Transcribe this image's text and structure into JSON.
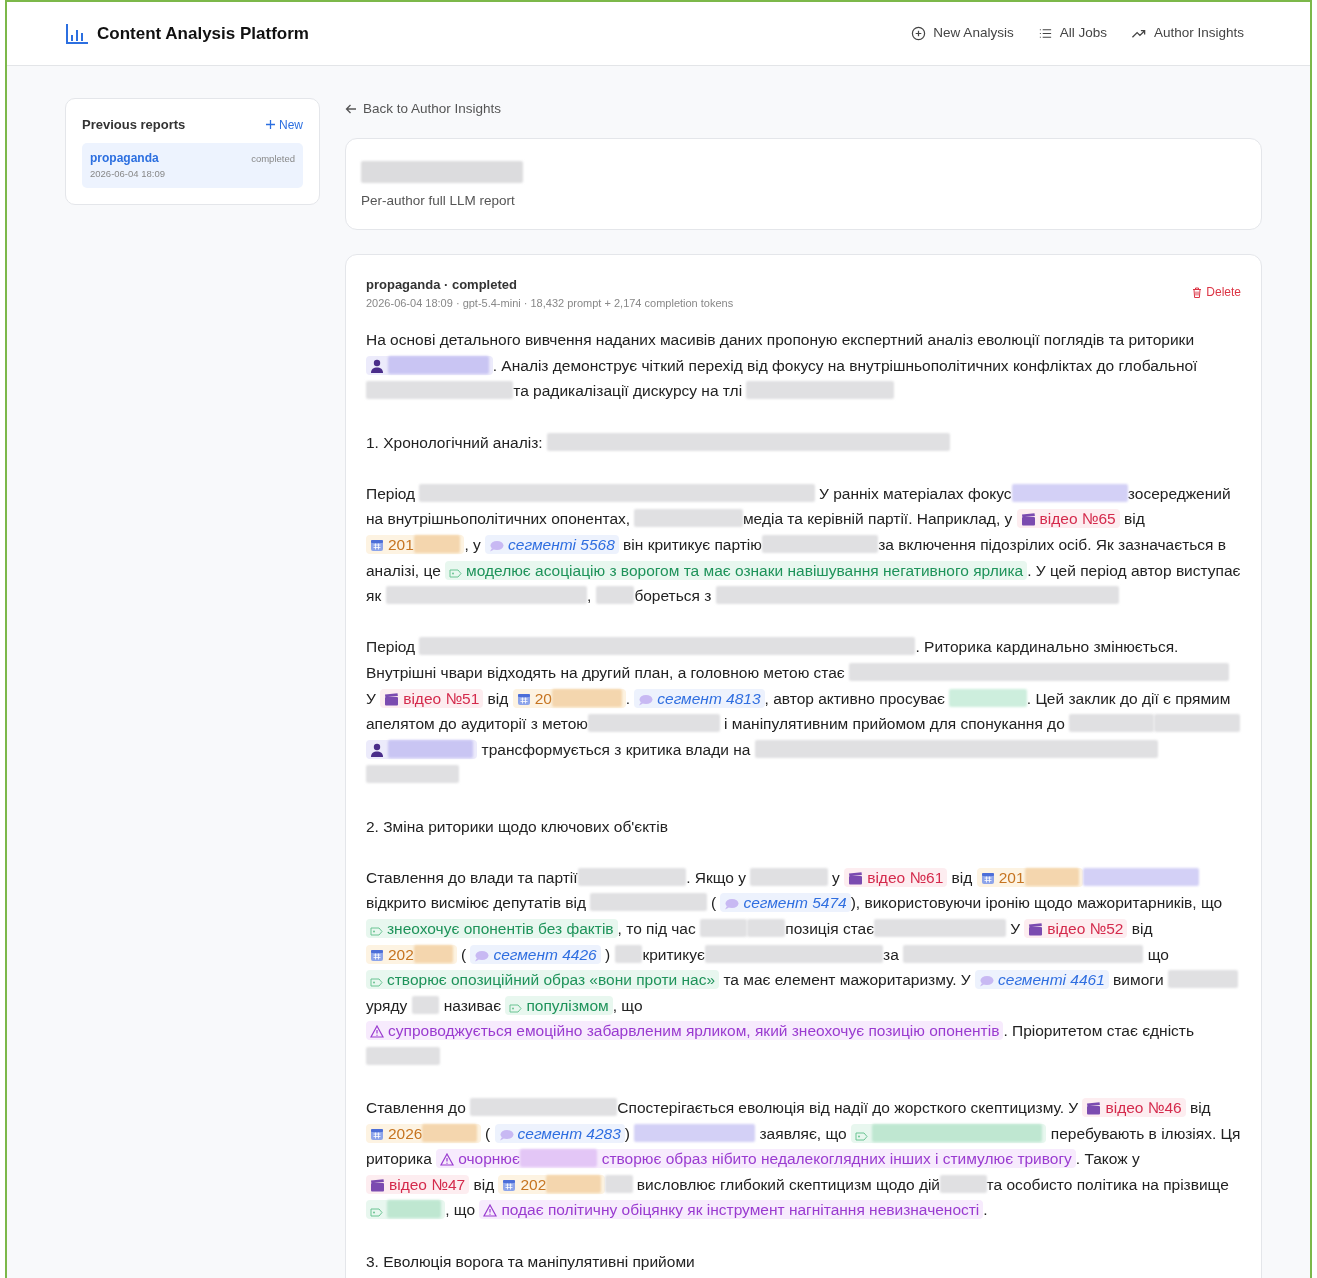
{
  "navbar": {
    "brand": "Content Analysis Platform",
    "links": [
      {
        "label": "New Analysis"
      },
      {
        "label": "All Jobs"
      },
      {
        "label": "Author Insights"
      }
    ]
  },
  "sidebar": {
    "title": "Previous reports",
    "new_label": "New",
    "reports": [
      {
        "name": "propaganda",
        "status": "completed",
        "date": "2026-06-04 18:09",
        "selected": true
      }
    ]
  },
  "back_link": "Back to Author Insights",
  "report_header": {
    "title_redacted": true,
    "subtitle": "Per-author full LLM report"
  },
  "report": {
    "title": "propaganda · completed",
    "meta": "2026-06-04 18:09 · gpt-5.4-mini · 18,432 prompt + 2,174 completion tokens",
    "delete_label": "Delete",
    "paragraphs": [
      [
        {
          "kind": "text",
          "text": "На основі детального вивчення наданих масивів даних пропоную експертний аналіз еволюції поглядів та риторики "
        },
        {
          "kind": "person",
          "parts": [
            {
              "redacted": true
            }
          ]
        },
        {
          "kind": "text",
          "text": ". Аналіз демонструє чіткий перехід від фокусу на внутрішньополітичних конфліктах до глобальної "
        },
        {
          "kind": "redacted",
          "color": "#e0e0e2"
        },
        {
          "kind": "text",
          "text": "та радикалізації дискурсу на тлі "
        },
        {
          "kind": "redacted",
          "color": "#e0e0e2"
        }
      ],
      [
        {
          "kind": "text",
          "text": "1. Хронологічний аналіз: "
        },
        {
          "kind": "redacted",
          "color": "#e0e0e2"
        }
      ],
      [
        {
          "kind": "text",
          "text": "Період "
        },
        {
          "kind": "redacted",
          "color": "#e0e0e2"
        },
        {
          "kind": "text",
          "text": " У ранніх матеріалах фокус"
        },
        {
          "kind": "redacted",
          "color": "#d3d0f6"
        },
        {
          "kind": "text",
          "text": "зосереджений на внутрішньополітичних опонентах, "
        },
        {
          "kind": "redacted",
          "color": "#e0e0e2"
        },
        {
          "kind": "text",
          "text": "медіа та керівній партії. Наприклад, у "
        },
        {
          "kind": "video",
          "parts": [
            {
              "text": "відео №65"
            }
          ]
        },
        {
          "kind": "text",
          "text": " від "
        },
        {
          "kind": "date",
          "parts": [
            {
              "text": "201"
            },
            {
              "redacted": true
            }
          ]
        },
        {
          "kind": "text",
          "text": ", у "
        },
        {
          "kind": "segment",
          "parts": [
            {
              "text": "сегменті 5568"
            }
          ]
        },
        {
          "kind": "text",
          "text": " він критикує партію"
        },
        {
          "kind": "redacted",
          "color": "#e0e0e2"
        },
        {
          "kind": "text",
          "text": "за включення підозрілих осіб. Як зазначається в аналізі, це "
        },
        {
          "kind": "tag",
          "parts": [
            {
              "text": "моделює асоціацію з ворогом та має ознаки навішування негативного ярлика"
            }
          ]
        },
        {
          "kind": "text",
          "text": ". У цей період автор виступає як "
        },
        {
          "kind": "redacted",
          "color": "#e0e0e2"
        },
        {
          "kind": "text",
          "text": ", "
        },
        {
          "kind": "redacted",
          "color": "#e0e0e2"
        },
        {
          "kind": "text",
          "text": "бореться з "
        },
        {
          "kind": "redacted",
          "color": "#e0e0e2"
        }
      ],
      [
        {
          "kind": "text",
          "text": "Період "
        },
        {
          "kind": "redacted",
          "color": "#e0e0e2"
        },
        {
          "kind": "text",
          "text": ". Риторика кардинально змінюється. Внутрішні чвари відходять на другий план, а головною метою стає "
        },
        {
          "kind": "redacted",
          "color": "#e0e0e2"
        },
        {
          "kind": "text",
          "text": " У "
        },
        {
          "kind": "video",
          "parts": [
            {
              "text": "відео №51"
            }
          ]
        },
        {
          "kind": "text",
          "text": " від "
        },
        {
          "kind": "date",
          "parts": [
            {
              "text": "20"
            },
            {
              "redacted": true
            }
          ]
        },
        {
          "kind": "text",
          "text": ". "
        },
        {
          "kind": "segment",
          "parts": [
            {
              "text": "сегмент 4813"
            }
          ]
        },
        {
          "kind": "text",
          "text": ", автор активно просуває "
        },
        {
          "kind": "redacted",
          "color": "#cdeedd"
        },
        {
          "kind": "text",
          "text": ". Цей заклик до дії є прямим апелятом до аудиторії з метою"
        },
        {
          "kind": "redacted",
          "color": "#e0e0e2"
        },
        {
          "kind": "text",
          "text": " і маніпулятивним прийомом для спонукання до "
        },
        {
          "kind": "redacted",
          "color": "#e0e0e2"
        },
        {
          "kind": "redacted",
          "color": "#e0e0e2"
        },
        {
          "kind": "person",
          "parts": [
            {
              "redacted": true
            }
          ]
        },
        {
          "kind": "text",
          "text": " трансформується з критика влади на "
        },
        {
          "kind": "redacted",
          "color": "#e0e0e2"
        },
        {
          "kind": "redacted",
          "color": "#e0e0e2"
        }
      ],
      [
        {
          "kind": "text",
          "text": "2. Зміна риторики щодо ключових об'єктів"
        }
      ],
      [
        {
          "kind": "text",
          "text": "Ставлення до влади та партії"
        },
        {
          "kind": "redacted",
          "color": "#e0e0e2"
        },
        {
          "kind": "text",
          "text": ". Якщо у "
        },
        {
          "kind": "redacted",
          "color": "#e0e0e2"
        },
        {
          "kind": "text",
          "text": " у "
        },
        {
          "kind": "video",
          "parts": [
            {
              "text": "відео №61"
            }
          ]
        },
        {
          "kind": "text",
          "text": " від "
        },
        {
          "kind": "date",
          "parts": [
            {
              "text": "201"
            },
            {
              "redacted": true
            }
          ]
        },
        {
          "kind": "redacted",
          "color": "#d3d0f6"
        },
        {
          "kind": "text",
          "text": " відкрито висміює депутатів від "
        },
        {
          "kind": "redacted",
          "color": "#e0e0e2"
        },
        {
          "kind": "text",
          "text": " ( "
        },
        {
          "kind": "segment",
          "parts": [
            {
              "text": "сегмент 5474"
            }
          ]
        },
        {
          "kind": "text",
          "text": "), використовуючи іронію щодо мажоритарників, що "
        },
        {
          "kind": "tag",
          "parts": [
            {
              "text": "знеохочує опонентів без фактів"
            }
          ]
        },
        {
          "kind": "text",
          "text": ", то під час "
        },
        {
          "kind": "redacted",
          "color": "#e0e0e2"
        },
        {
          "kind": "redacted",
          "color": "#e0e0e2"
        },
        {
          "kind": "text",
          "text": "позиція стає"
        },
        {
          "kind": "redacted",
          "color": "#e0e0e2"
        },
        {
          "kind": "text",
          "text": " У "
        },
        {
          "kind": "video",
          "parts": [
            {
              "text": "відео №52"
            }
          ]
        },
        {
          "kind": "text",
          "text": " від "
        },
        {
          "kind": "date",
          "parts": [
            {
              "text": "202"
            },
            {
              "redacted": true
            }
          ]
        },
        {
          "kind": "text",
          "text": " ( "
        },
        {
          "kind": "segment",
          "parts": [
            {
              "text": "сегмент 4426"
            }
          ]
        },
        {
          "kind": "text",
          "text": " ) "
        },
        {
          "kind": "redacted",
          "color": "#e0e0e2"
        },
        {
          "kind": "text",
          "text": "критикує"
        },
        {
          "kind": "redacted",
          "color": "#e0e0e2"
        },
        {
          "kind": "text",
          "text": "за "
        },
        {
          "kind": "redacted",
          "color": "#e0e0e2"
        },
        {
          "kind": "text",
          "text": " що "
        },
        {
          "kind": "tag",
          "parts": [
            {
              "text": "створює опозиційний образ «вони проти нас»"
            }
          ]
        },
        {
          "kind": "text",
          "text": " та має елемент мажоритаризму. У "
        },
        {
          "kind": "segment",
          "parts": [
            {
              "text": "сегменті 4461"
            }
          ]
        },
        {
          "kind": "text",
          "text": " вимоги "
        },
        {
          "kind": "redacted",
          "color": "#e0e0e2"
        },
        {
          "kind": "text",
          "text": " уряду "
        },
        {
          "kind": "redacted",
          "color": "#e0e0e2"
        },
        {
          "kind": "text",
          "text": " називає "
        },
        {
          "kind": "tag",
          "parts": [
            {
              "text": "популізмом"
            }
          ]
        },
        {
          "kind": "text",
          "text": ", що "
        },
        {
          "kind": "warning",
          "parts": [
            {
              "text": "супроводжується емоційно забарвленим ярликом, який знеохочує позицію опонентів"
            }
          ]
        },
        {
          "kind": "text",
          "text": ". Пріоритетом стає єдність"
        },
        {
          "kind": "redacted",
          "color": "#e0e0e2"
        }
      ],
      [
        {
          "kind": "text",
          "text": "Ставлення до "
        },
        {
          "kind": "redacted",
          "color": "#e0e0e2"
        },
        {
          "kind": "text",
          "text": "Спостерігається еволюція від надії до жорсткого скептицизму. У "
        },
        {
          "kind": "video",
          "parts": [
            {
              "text": "відео №46"
            }
          ]
        },
        {
          "kind": "text",
          "text": " від "
        },
        {
          "kind": "date",
          "parts": [
            {
              "text": "2026"
            },
            {
              "redacted": true
            }
          ]
        },
        {
          "kind": "text",
          "text": " ( "
        },
        {
          "kind": "segment",
          "parts": [
            {
              "text": "сегмент 4283"
            }
          ]
        },
        {
          "kind": "text",
          "text": ") "
        },
        {
          "kind": "redacted",
          "color": "#d3d0f6"
        },
        {
          "kind": "text",
          "text": " заявляє, що "
        },
        {
          "kind": "tag",
          "parts": [
            {
              "redacted": true
            }
          ]
        },
        {
          "kind": "text",
          "text": " перебувають в ілюзіях. Ця риторика "
        },
        {
          "kind": "warning",
          "parts": [
            {
              "text": "очорнює"
            },
            {
              "redacted": true
            },
            {
              "text": " створює образ нібито недалекоглядних інших і стимулює тривогу"
            }
          ]
        },
        {
          "kind": "text",
          "text": ". Також у "
        },
        {
          "kind": "video",
          "parts": [
            {
              "text": "відео №47"
            }
          ]
        },
        {
          "kind": "text",
          "text": " від "
        },
        {
          "kind": "date",
          "parts": [
            {
              "text": "202"
            },
            {
              "redacted": true
            }
          ]
        },
        {
          "kind": "redacted",
          "color": "#e0e0e2"
        },
        {
          "kind": "text",
          "text": " висловлює глибокий скептицизм щодо дій"
        },
        {
          "kind": "redacted",
          "color": "#e0e0e2"
        },
        {
          "kind": "text",
          "text": "та особисто політика на прізвище "
        },
        {
          "kind": "tag",
          "parts": [
            {
              "redacted": true
            }
          ]
        },
        {
          "kind": "text",
          "text": ", що "
        },
        {
          "kind": "warning",
          "parts": [
            {
              "text": "подає політичну обіцянку як інструмент нагнітання невизначеності"
            }
          ]
        },
        {
          "kind": "text",
          "text": "."
        }
      ],
      [
        {
          "kind": "text",
          "text": "3. Еволюція ворога та маніпулятивні прийоми"
        }
      ]
    ]
  }
}
